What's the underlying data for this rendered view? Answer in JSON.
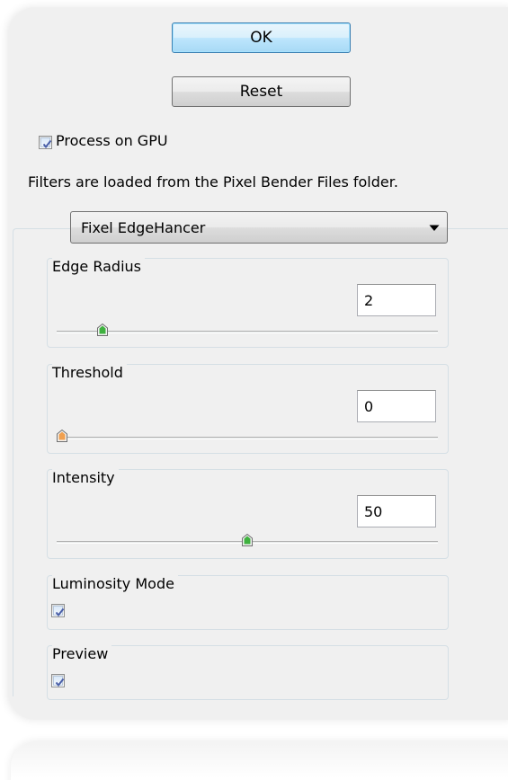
{
  "buttons": {
    "ok_label": "OK",
    "reset_label": "Reset"
  },
  "gpu": {
    "label": "Process on GPU",
    "checked": true
  },
  "info_text": "Filters are loaded from the Pixel Bender Files folder.",
  "filter_select": {
    "selected": "Fixel EdgeHancer"
  },
  "params": {
    "edge_radius": {
      "title": "Edge Radius",
      "value": "2",
      "slider_fraction": 0.11
    },
    "threshold": {
      "title": "Threshold",
      "value": "0",
      "slider_fraction": 0.0
    },
    "intensity": {
      "title": "Intensity",
      "value": "50",
      "slider_fraction": 0.5
    }
  },
  "luminosity": {
    "title": "Luminosity Mode",
    "checked": true
  },
  "preview": {
    "title": "Preview",
    "checked": true
  },
  "colors": {
    "panel_bg": "#f0f0f0",
    "default_button_border": "#3c7fb1",
    "slider_thumb_green": "#3fb13f",
    "slider_thumb_orange": "#f0a050",
    "checkmark": "#4a5fa8"
  },
  "icons": {
    "checkbox_check": "checkmark-icon",
    "dropdown": "chevron-down-icon",
    "slider_thumb": "slider-thumb-icon"
  }
}
